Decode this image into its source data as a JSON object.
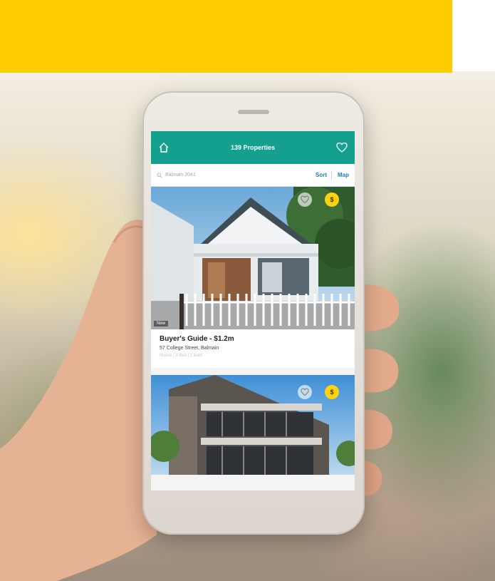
{
  "app": {
    "title": "139 Properties",
    "search_location": "Balmain 2041",
    "sort_label": "Sort",
    "map_label": "Map"
  },
  "icons": {
    "home": "home-icon",
    "favourites": "heart-icon",
    "search": "search-icon",
    "save": "heart-icon",
    "price": "dollar-coin-icon"
  },
  "listings": [
    {
      "title": "Buyer's Guide - $1.2m",
      "address": "57 College Street, Balmain",
      "meta": "House | 3 Bed | 1 Bath",
      "tag": "New",
      "coin_label": "$"
    },
    {
      "coin_label": "$"
    }
  ],
  "colors": {
    "banner": "#ffcd00",
    "header": "#13a08e",
    "link": "#1a7fb4",
    "coin": "#ffd20f"
  }
}
